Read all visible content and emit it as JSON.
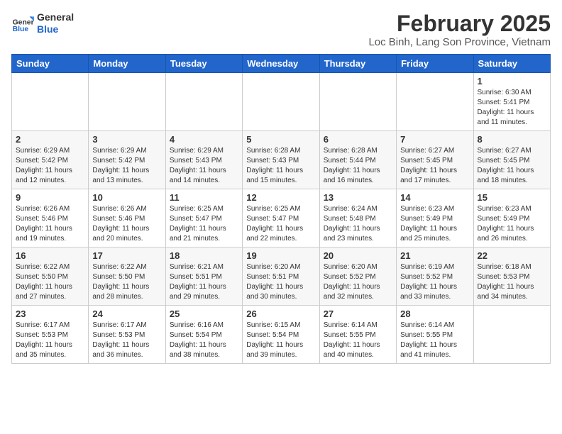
{
  "header": {
    "logo_general": "General",
    "logo_blue": "Blue",
    "title": "February 2025",
    "subtitle": "Loc Binh, Lang Son Province, Vietnam"
  },
  "weekdays": [
    "Sunday",
    "Monday",
    "Tuesday",
    "Wednesday",
    "Thursday",
    "Friday",
    "Saturday"
  ],
  "weeks": [
    [
      {
        "day": "",
        "info": ""
      },
      {
        "day": "",
        "info": ""
      },
      {
        "day": "",
        "info": ""
      },
      {
        "day": "",
        "info": ""
      },
      {
        "day": "",
        "info": ""
      },
      {
        "day": "",
        "info": ""
      },
      {
        "day": "1",
        "info": "Sunrise: 6:30 AM\nSunset: 5:41 PM\nDaylight: 11 hours and 11 minutes."
      }
    ],
    [
      {
        "day": "2",
        "info": "Sunrise: 6:29 AM\nSunset: 5:42 PM\nDaylight: 11 hours and 12 minutes."
      },
      {
        "day": "3",
        "info": "Sunrise: 6:29 AM\nSunset: 5:42 PM\nDaylight: 11 hours and 13 minutes."
      },
      {
        "day": "4",
        "info": "Sunrise: 6:29 AM\nSunset: 5:43 PM\nDaylight: 11 hours and 14 minutes."
      },
      {
        "day": "5",
        "info": "Sunrise: 6:28 AM\nSunset: 5:43 PM\nDaylight: 11 hours and 15 minutes."
      },
      {
        "day": "6",
        "info": "Sunrise: 6:28 AM\nSunset: 5:44 PM\nDaylight: 11 hours and 16 minutes."
      },
      {
        "day": "7",
        "info": "Sunrise: 6:27 AM\nSunset: 5:45 PM\nDaylight: 11 hours and 17 minutes."
      },
      {
        "day": "8",
        "info": "Sunrise: 6:27 AM\nSunset: 5:45 PM\nDaylight: 11 hours and 18 minutes."
      }
    ],
    [
      {
        "day": "9",
        "info": "Sunrise: 6:26 AM\nSunset: 5:46 PM\nDaylight: 11 hours and 19 minutes."
      },
      {
        "day": "10",
        "info": "Sunrise: 6:26 AM\nSunset: 5:46 PM\nDaylight: 11 hours and 20 minutes."
      },
      {
        "day": "11",
        "info": "Sunrise: 6:25 AM\nSunset: 5:47 PM\nDaylight: 11 hours and 21 minutes."
      },
      {
        "day": "12",
        "info": "Sunrise: 6:25 AM\nSunset: 5:47 PM\nDaylight: 11 hours and 22 minutes."
      },
      {
        "day": "13",
        "info": "Sunrise: 6:24 AM\nSunset: 5:48 PM\nDaylight: 11 hours and 23 minutes."
      },
      {
        "day": "14",
        "info": "Sunrise: 6:23 AM\nSunset: 5:49 PM\nDaylight: 11 hours and 25 minutes."
      },
      {
        "day": "15",
        "info": "Sunrise: 6:23 AM\nSunset: 5:49 PM\nDaylight: 11 hours and 26 minutes."
      }
    ],
    [
      {
        "day": "16",
        "info": "Sunrise: 6:22 AM\nSunset: 5:50 PM\nDaylight: 11 hours and 27 minutes."
      },
      {
        "day": "17",
        "info": "Sunrise: 6:22 AM\nSunset: 5:50 PM\nDaylight: 11 hours and 28 minutes."
      },
      {
        "day": "18",
        "info": "Sunrise: 6:21 AM\nSunset: 5:51 PM\nDaylight: 11 hours and 29 minutes."
      },
      {
        "day": "19",
        "info": "Sunrise: 6:20 AM\nSunset: 5:51 PM\nDaylight: 11 hours and 30 minutes."
      },
      {
        "day": "20",
        "info": "Sunrise: 6:20 AM\nSunset: 5:52 PM\nDaylight: 11 hours and 32 minutes."
      },
      {
        "day": "21",
        "info": "Sunrise: 6:19 AM\nSunset: 5:52 PM\nDaylight: 11 hours and 33 minutes."
      },
      {
        "day": "22",
        "info": "Sunrise: 6:18 AM\nSunset: 5:53 PM\nDaylight: 11 hours and 34 minutes."
      }
    ],
    [
      {
        "day": "23",
        "info": "Sunrise: 6:17 AM\nSunset: 5:53 PM\nDaylight: 11 hours and 35 minutes."
      },
      {
        "day": "24",
        "info": "Sunrise: 6:17 AM\nSunset: 5:53 PM\nDaylight: 11 hours and 36 minutes."
      },
      {
        "day": "25",
        "info": "Sunrise: 6:16 AM\nSunset: 5:54 PM\nDaylight: 11 hours and 38 minutes."
      },
      {
        "day": "26",
        "info": "Sunrise: 6:15 AM\nSunset: 5:54 PM\nDaylight: 11 hours and 39 minutes."
      },
      {
        "day": "27",
        "info": "Sunrise: 6:14 AM\nSunset: 5:55 PM\nDaylight: 11 hours and 40 minutes."
      },
      {
        "day": "28",
        "info": "Sunrise: 6:14 AM\nSunset: 5:55 PM\nDaylight: 11 hours and 41 minutes."
      },
      {
        "day": "",
        "info": ""
      }
    ]
  ]
}
